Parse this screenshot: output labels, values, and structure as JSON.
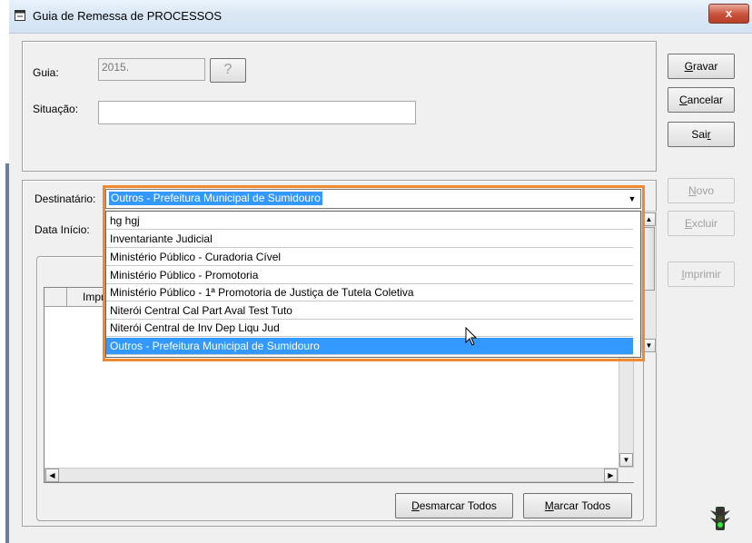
{
  "window": {
    "title": "Guia de Remessa de PROCESSOS",
    "close_label": "x"
  },
  "form": {
    "guia_label": "Guia:",
    "guia_value": "2015.",
    "lookup_label": "?",
    "situacao_label": "Situação:",
    "situacao_value": "",
    "destinatario_label": "Destinatário:",
    "destinatario_value": "Outros - Prefeitura Municipal de Sumidouro",
    "data_inicio_label": "Data Início:"
  },
  "dropdown": {
    "items": [
      "hg hgj",
      "Inventariante Judicial",
      "Ministério Público - Curadoria Cível",
      "Ministério Público - Promotoria",
      "Ministério Público - 1ª Promotoria de Justiça de Tutela Coletiva",
      "Niterói Central Cal Part Aval Test Tuto",
      "Niterói Central de Inv Dep Liqu Jud",
      "Outros - Prefeitura Municipal de Sumidouro"
    ],
    "selected_index": 7
  },
  "grid": {
    "col_imprimir": "Impri"
  },
  "buttons": {
    "gravar": {
      "pre": "",
      "ul": "G",
      "post": "ravar"
    },
    "cancelar": {
      "pre": "",
      "ul": "C",
      "post": "ancelar"
    },
    "sair": {
      "pre": "Sai",
      "ul": "r",
      "post": ""
    },
    "novo": {
      "pre": "",
      "ul": "N",
      "post": "ovo"
    },
    "excluir": {
      "pre": "",
      "ul": "E",
      "post": "xcluir"
    },
    "imprimir": {
      "pre": "",
      "ul": "I",
      "post": "mprimir"
    },
    "desmarcar": {
      "pre": "",
      "ul": "D",
      "post": "esmarcar Todos"
    },
    "marcar": {
      "pre": "",
      "ul": "M",
      "post": "arcar Todos"
    }
  },
  "icons": {
    "window": "form-icon",
    "status": "traffic-light-icon",
    "cursor": "mouse-pointer-icon"
  },
  "colors": {
    "accent": "#3399ff",
    "highlight_border": "#f08a30",
    "close": "#c8513a"
  }
}
